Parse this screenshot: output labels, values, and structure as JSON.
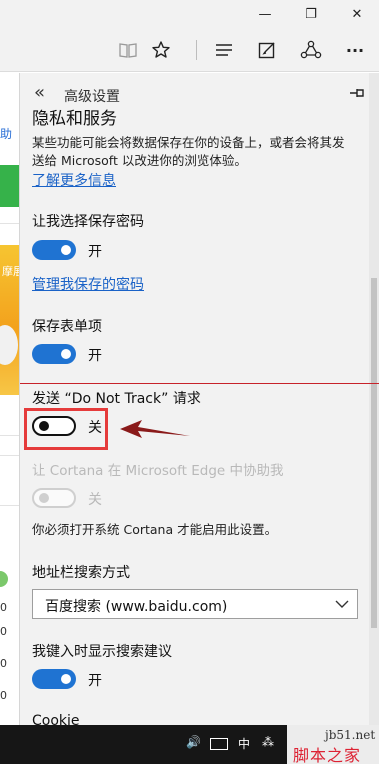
{
  "window": {
    "minimize_glyph": "—",
    "restore_glyph": "❐",
    "close_glyph": "✕"
  },
  "toolbar": {
    "icons": [
      "reading-view-icon",
      "favorite-star-icon",
      "hub-icon",
      "web-note-icon",
      "share-icon",
      "more-icon"
    ],
    "more_glyph": "···"
  },
  "background_page": {
    "link_fragment": "助",
    "banner_fragment": "摩展",
    "numbers": [
      "0",
      "0",
      "0",
      "0"
    ]
  },
  "panel": {
    "back_glyph": "«",
    "title": "高级设置",
    "privacy_heading": "隐私和服务",
    "privacy_desc_line1": "某些功能可能会将数据保存在你的设备上，或者会将其发",
    "privacy_desc_line2": "送给 Microsoft 以改进你的浏览体验。",
    "learn_more": "了解更多信息",
    "save_passwords_label": "让我选择保存密码",
    "save_passwords_state": "开",
    "manage_passwords": "管理我保存的密码",
    "save_forms_label": "保存表单项",
    "save_forms_state": "开",
    "dnt_label": "发送 “Do Not Track” 请求",
    "dnt_state": "关",
    "cortana_label": "让 Cortana 在 Microsoft Edge 中协助我",
    "cortana_state": "关",
    "cortana_note": "你必须打开系统 Cortana 才能启用此设置。",
    "search_label": "地址栏搜索方式",
    "search_value": "百度搜索 (www.baidu.com)",
    "suggestions_label": "我键入时显示搜索建议",
    "suggestions_state": "开",
    "cookie_label": "Cookie"
  },
  "taskbar": {
    "volume_glyph": "🔊",
    "ime": "中",
    "tray_extra": "⁂"
  },
  "watermark": {
    "line1": "jb51.net",
    "line2": "脚本之家"
  },
  "colors": {
    "accent": "#1f73d2",
    "annotation_red": "#e53b3b",
    "panel_bg": "#f2f2f2"
  }
}
